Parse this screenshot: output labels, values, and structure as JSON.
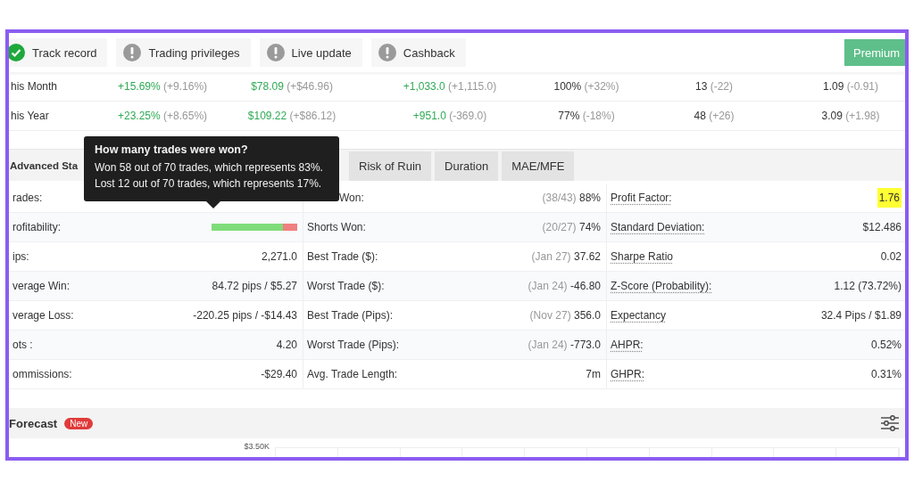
{
  "top_bar": {
    "items": [
      {
        "label": "Track record",
        "kind": "ok"
      },
      {
        "label": "Trading privileges",
        "kind": "warning"
      },
      {
        "label": "Live update",
        "kind": "warning"
      },
      {
        "label": "Cashback",
        "kind": "warning"
      }
    ],
    "premium_button": "Premium"
  },
  "summary_rows": [
    {
      "label": "his Month",
      "cells": [
        {
          "value": "+15.69%",
          "change": "(+9.16%)",
          "positive": true
        },
        {
          "value": "$78.09",
          "change": "(+$46.96)",
          "positive": true
        },
        {
          "value": "+1,033.0",
          "change": "(+1,115.0)",
          "positive": true
        },
        {
          "value": "100%",
          "change": "(+32%)",
          "positive": false
        },
        {
          "value": "13",
          "change": "(-22)",
          "positive": false
        },
        {
          "value": "1.09",
          "change": "(-0.91)",
          "positive": false
        }
      ]
    },
    {
      "label": "his Year",
      "cells": [
        {
          "value": "+23.25%",
          "change": "(+8.65%)",
          "positive": true
        },
        {
          "value": "$109.22",
          "change": "(+$86.12)",
          "positive": true
        },
        {
          "value": "+951.0",
          "change": "(-369.0)",
          "positive": true
        },
        {
          "value": "77%",
          "change": "(-18%)",
          "positive": false
        },
        {
          "value": "48",
          "change": "(+26)",
          "positive": false
        },
        {
          "value": "3.09",
          "change": "(+1.98)",
          "positive": false
        }
      ]
    }
  ],
  "advanced_stats": {
    "title": "Advanced Sta",
    "tabs": [
      {
        "label": "Risk of Ruin",
        "selected": false
      },
      {
        "label": "Duration",
        "selected": false
      },
      {
        "label": "MAE/MFE",
        "selected": false
      }
    ],
    "tooltip": {
      "title": "How many trades were won?",
      "lines": [
        "Won 58 out of 70 trades, which represents 83%.",
        "Lost 12 out of 70 trades, which represents 17%."
      ]
    },
    "rows": [
      [
        {
          "label": "rades:"
        },
        {
          "label": "Won:",
          "note": "(38/43)",
          "value": "88%"
        },
        {
          "label": "Profit Factor:",
          "value": "1.76",
          "highlighted": true
        }
      ],
      [
        {
          "label": "rofitability:",
          "kind": "bar",
          "level": 0.83
        },
        {
          "label": "Shorts Won:",
          "note": "(20/27)",
          "value": "74%"
        },
        {
          "label": "Standard Deviation:",
          "value": "$12.486",
          "highlighted": false
        }
      ],
      [
        {
          "label": "ips:",
          "value": "2,271.0"
        },
        {
          "label": "Best Trade ($):",
          "note": "(Jan 27)",
          "value": "37.62"
        },
        {
          "label": "Sharpe Ratio",
          "value": "0.02",
          "highlighted": false
        }
      ],
      [
        {
          "label": "verage Win:",
          "value": "84.72 pips / $5.27"
        },
        {
          "label": "Worst Trade ($):",
          "note": "(Jan 24)",
          "value": "-46.80"
        },
        {
          "label": "Z-Score (Probability):",
          "value": "1.12 (73.72%)",
          "highlighted": false
        }
      ],
      [
        {
          "label": "verage Loss:",
          "value": "-220.25 pips / -$14.43"
        },
        {
          "label": "Best Trade (Pips):",
          "note": "(Nov 27)",
          "value": "356.0"
        },
        {
          "label": "Expectancy",
          "value": "32.4 Pips / $1.89",
          "highlighted": false
        }
      ],
      [
        {
          "label": "ots :",
          "value": "4.20"
        },
        {
          "label": "Worst Trade (Pips):",
          "note": "(Jan 24)",
          "value": "-773.0"
        },
        {
          "label": "AHPR:",
          "value": "0.52%",
          "highlighted": false
        }
      ],
      [
        {
          "label": "ommissions:",
          "value": "-$29.40"
        },
        {
          "label": "Avg. Trade Length:",
          "value": "7m"
        },
        {
          "label": "GHPR:",
          "value": "0.31%",
          "highlighted": false
        }
      ]
    ]
  },
  "forecast": {
    "title": "Forecast",
    "badge": "New",
    "axis_label": "$3.50K"
  }
}
